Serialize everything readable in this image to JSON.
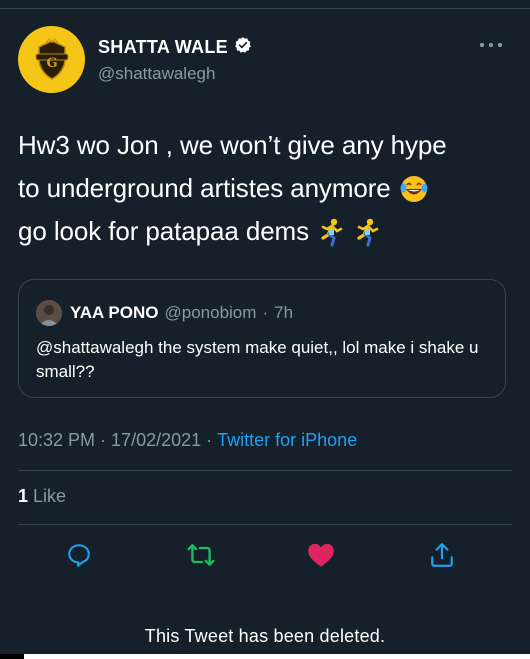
{
  "tweet": {
    "author": {
      "display_name": "SHATTA WALE",
      "handle": "@shattawalegh",
      "verified": true,
      "avatar_bg": "#f5c518"
    },
    "text_lines": [
      "Hw3 wo Jon , we won’t give any hype",
      "to underground artistes anymore",
      "go look for patapaa dems"
    ],
    "emojis": {
      "line2": "face-with-tears-of-joy",
      "line3": [
        "person-running",
        "person-running"
      ]
    },
    "quote": {
      "display_name": "YAA PONO",
      "handle": "@ponobiom",
      "separator": "·",
      "time": "7h",
      "text": "@shattawalegh the system make quiet,, lol make i shake u small??"
    },
    "meta": {
      "time": "10:32 PM",
      "sep1": "·",
      "date": "17/02/2021",
      "sep2": "·",
      "source": "Twitter for iPhone"
    },
    "likes": {
      "count": "1",
      "label": "Like"
    },
    "actions": [
      "reply-icon",
      "retweet-icon",
      "like-icon",
      "share-icon"
    ],
    "colors": {
      "background": "#15202b",
      "border": "#38444d",
      "muted": "#8899a6",
      "link": "#1da1f2",
      "retweet": "#17bf63",
      "like": "#e0245e"
    }
  },
  "notice": {
    "text": "This Tweet has been deleted."
  }
}
